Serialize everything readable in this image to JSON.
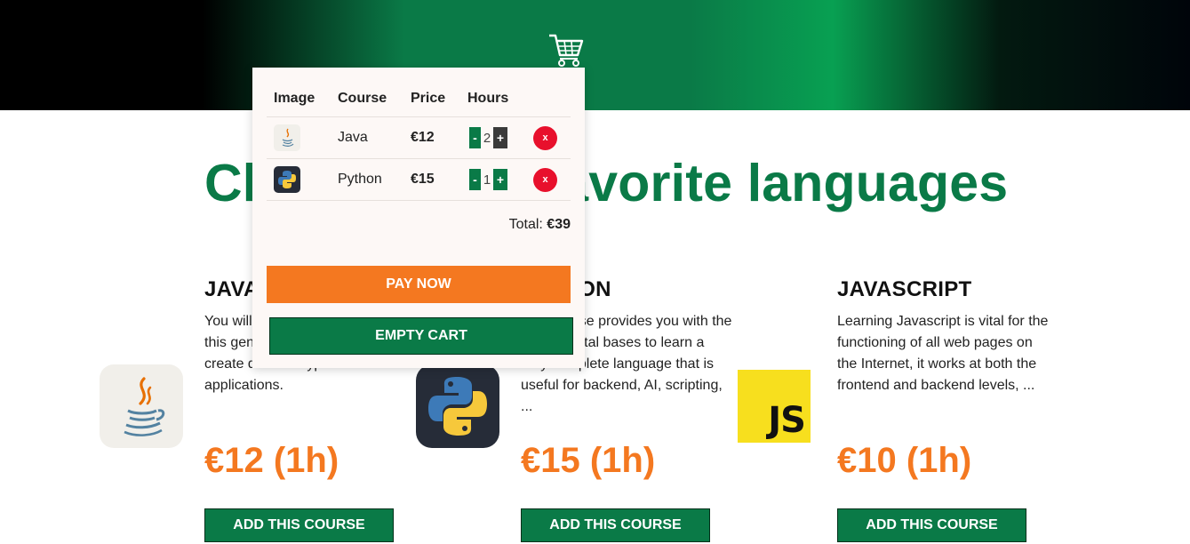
{
  "header": {
    "cart_icon": "shopping-cart-icon"
  },
  "headline": "Choose your favorite languages",
  "courses": [
    {
      "title": "JAVA",
      "description": "You will learn the fundamentals of this general purpose language to create different types of applications.",
      "price": "€12 (1h)",
      "button": "ADD THIS COURSE",
      "icon": "java-logo-icon"
    },
    {
      "title": "PYTHON",
      "description": "This course provides you with the fundamental bases to learn a very complete language that is useful for backend, AI, scripting, ...",
      "price": "€15 (1h)",
      "button": "ADD THIS COURSE",
      "icon": "python-logo-icon"
    },
    {
      "title": "JAVASCRIPT",
      "description": "Learning Javascript is vital for the functioning of all web pages on the Internet, it works at both the frontend and backend levels, ...",
      "price": "€10 (1h)",
      "button": "ADD THIS COURSE",
      "icon": "js-logo-icon",
      "logo_text": "JS"
    }
  ],
  "cart": {
    "headers": [
      "Image",
      "Course",
      "Price",
      "Hours"
    ],
    "items": [
      {
        "course": "Java",
        "price": "€12",
        "hours": "2",
        "minus": "-",
        "plus": "+",
        "remove": "x"
      },
      {
        "course": "Python",
        "price": "€15",
        "hours": "1",
        "minus": "-",
        "plus": "+",
        "remove": "x"
      }
    ],
    "total_label": "Total:",
    "total_value": "€39",
    "pay_button": "PAY NOW",
    "empty_button": "EMPTY CART"
  },
  "colors": {
    "brand_green": "#0a7a47",
    "accent_orange": "#f47820",
    "remove_red": "#e8102c"
  }
}
